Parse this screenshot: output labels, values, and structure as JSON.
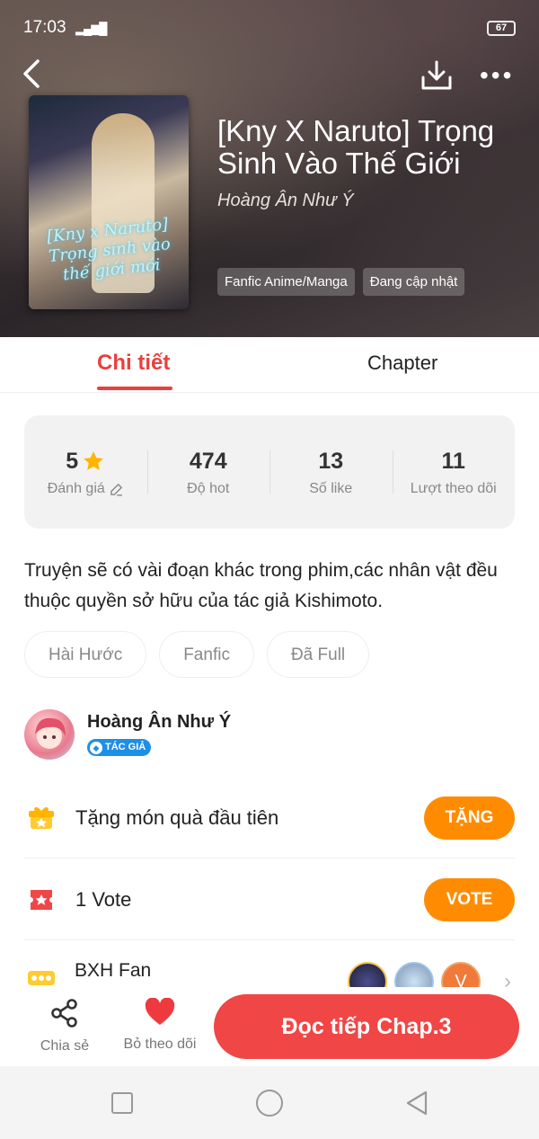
{
  "status_bar": {
    "time": "17:03",
    "signal": "▂▄▆█",
    "battery": "67"
  },
  "header": {
    "title": "[Kny X Naruto] Trọng Sinh Vào Thế Giới",
    "author": "Hoàng Ân Như Ý",
    "cover_text": "[Kny x Naruto] Trọng sinh vào thế giới mới",
    "tags": [
      "Fanfic Anime/Manga",
      "Đang cập nhật"
    ]
  },
  "tabs": [
    {
      "label": "Chi tiết",
      "active": true
    },
    {
      "label": "Chapter",
      "active": false
    }
  ],
  "stats": [
    {
      "value": "5",
      "label": "Đánh giá",
      "icon": "star-icon"
    },
    {
      "value": "474",
      "label": "Độ hot"
    },
    {
      "value": "13",
      "label": "Số like"
    },
    {
      "value": "11",
      "label": "Lượt theo dõi"
    }
  ],
  "description": "Truyện sẽ có vài đoạn khác trong phim,các nhân vật đều thuộc quyền sở hữu của tác giả Kishimoto.",
  "genres": [
    "Hài Hước",
    "Fanfic",
    "Đã Full"
  ],
  "author_block": {
    "name": "Hoàng Ân Như Ý",
    "badge": "TÁC GIẢ"
  },
  "gift_row": {
    "label": "Tặng món quà đầu tiên",
    "button": "TẶNG"
  },
  "vote_row": {
    "label": "1 Vote",
    "button": "VOTE"
  },
  "fan_row": {
    "label": "BXH Fan",
    "third_avatar_letter": "V"
  },
  "bottom_bar": {
    "share": "Chia sẻ",
    "unfollow": "Bỏ theo dõi",
    "read": "Đọc tiếp Chap.3"
  },
  "colors": {
    "accent": "#e8413d",
    "orange": "#ff8c00",
    "read_button": "#f04646",
    "badge": "#1e8fe6"
  }
}
